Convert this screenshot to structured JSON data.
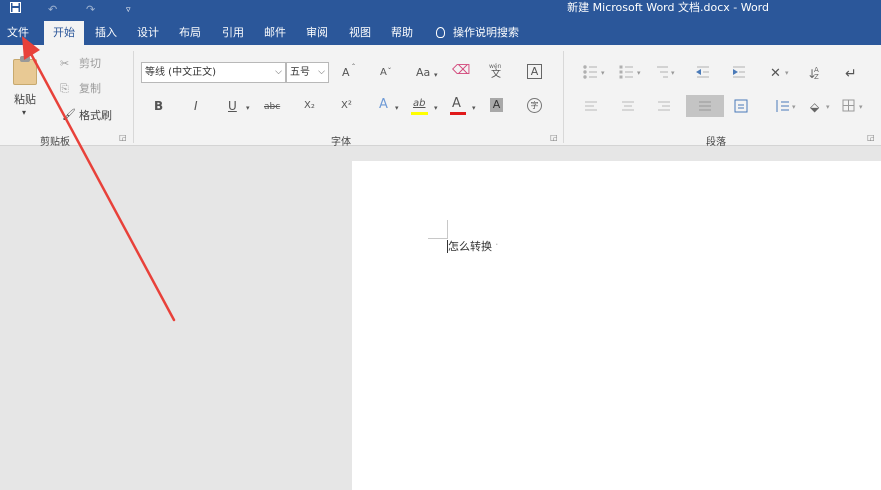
{
  "titlebar": {
    "title": "新建 Microsoft Word 文档.docx  -  Word",
    "quick_access": [
      "save-icon",
      "undo-icon",
      "redo-icon",
      "customize-icon"
    ]
  },
  "tabs": [
    {
      "label": "文件"
    },
    {
      "label": "开始",
      "active": true
    },
    {
      "label": "插入"
    },
    {
      "label": "设计"
    },
    {
      "label": "布局"
    },
    {
      "label": "引用"
    },
    {
      "label": "邮件"
    },
    {
      "label": "审阅"
    },
    {
      "label": "视图"
    },
    {
      "label": "帮助"
    }
  ],
  "search_label": "操作说明搜索",
  "clipboard": {
    "paste": "粘贴",
    "cut": "剪切",
    "copy": "复制",
    "format_painter": "格式刷",
    "label": "剪贴板"
  },
  "font": {
    "font_name": "等线 (中文正文)",
    "font_size": "五号",
    "label": "字体",
    "grow": "A",
    "shrink": "A",
    "case": "Aa",
    "phonetic": "文",
    "phonetic_top": "wén",
    "bold": "B",
    "italic": "I",
    "underline": "U",
    "strike": "abc",
    "subscript": "X₂",
    "superscript": "X²",
    "effects": "A",
    "highlight": "ab",
    "font_color": "A",
    "shading": "A",
    "encircle": "字",
    "border": "A"
  },
  "paragraph": {
    "label": "段落"
  },
  "document": {
    "text": "怎么转换"
  },
  "colors": {
    "accent": "#2b579a",
    "highlight": "#ffff00",
    "font_color": "#e0191a",
    "arrow": "#e8413a"
  }
}
